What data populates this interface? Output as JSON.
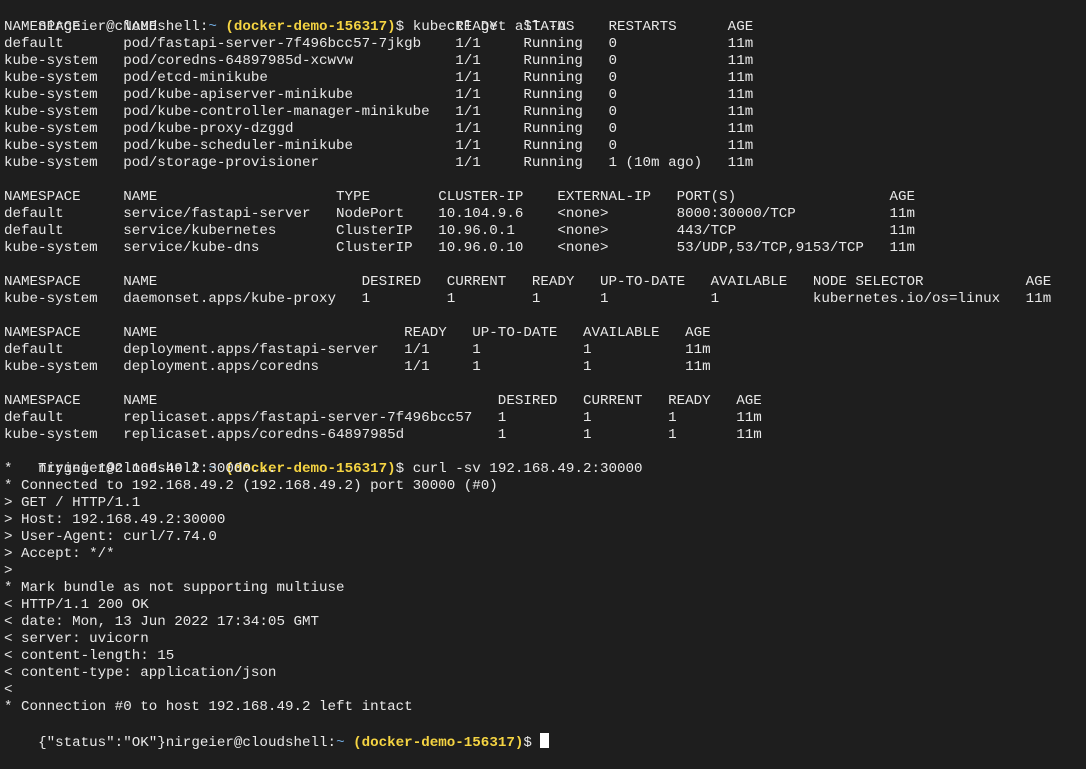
{
  "prompt": {
    "user_host": "nirgeier@cloudshell:",
    "cwd": "~",
    "project": "(docker-demo-156317)",
    "symbol": "$"
  },
  "commands": [
    "kubectl get all -A",
    "curl -sv 192.168.49.2:30000"
  ],
  "lines": [
    "NAMESPACE     NAME                                   READY   STATUS    RESTARTS      AGE",
    "default       pod/fastapi-server-7f496bcc57-7jkgb    1/1     Running   0             11m",
    "kube-system   pod/coredns-64897985d-xcwvw            1/1     Running   0             11m",
    "kube-system   pod/etcd-minikube                      1/1     Running   0             11m",
    "kube-system   pod/kube-apiserver-minikube            1/1     Running   0             11m",
    "kube-system   pod/kube-controller-manager-minikube   1/1     Running   0             11m",
    "kube-system   pod/kube-proxy-dzggd                   1/1     Running   0             11m",
    "kube-system   pod/kube-scheduler-minikube            1/1     Running   0             11m",
    "kube-system   pod/storage-provisioner                1/1     Running   1 (10m ago)   11m",
    "",
    "NAMESPACE     NAME                     TYPE        CLUSTER-IP    EXTERNAL-IP   PORT(S)                  AGE",
    "default       service/fastapi-server   NodePort    10.104.9.6    <none>        8000:30000/TCP           11m",
    "default       service/kubernetes       ClusterIP   10.96.0.1     <none>        443/TCP                  11m",
    "kube-system   service/kube-dns         ClusterIP   10.96.0.10    <none>        53/UDP,53/TCP,9153/TCP   11m",
    "",
    "NAMESPACE     NAME                        DESIRED   CURRENT   READY   UP-TO-DATE   AVAILABLE   NODE SELECTOR            AGE",
    "kube-system   daemonset.apps/kube-proxy   1         1         1       1            1           kubernetes.io/os=linux   11m",
    "",
    "NAMESPACE     NAME                             READY   UP-TO-DATE   AVAILABLE   AGE",
    "default       deployment.apps/fastapi-server   1/1     1            1           11m",
    "kube-system   deployment.apps/coredns          1/1     1            1           11m",
    "",
    "NAMESPACE     NAME                                        DESIRED   CURRENT   READY   AGE",
    "default       replicaset.apps/fastapi-server-7f496bcc57   1         1         1       11m",
    "kube-system   replicaset.apps/coredns-64897985d           1         1         1       11m"
  ],
  "curl_lines": [
    "*   Trying 192.168.49.2:30000...",
    "* Connected to 192.168.49.2 (192.168.49.2) port 30000 (#0)",
    "> GET / HTTP/1.1",
    "> Host: 192.168.49.2:30000",
    "> User-Agent: curl/7.74.0",
    "> Accept: */*",
    ">",
    "* Mark bundle as not supporting multiuse",
    "< HTTP/1.1 200 OK",
    "< date: Mon, 13 Jun 2022 17:34:05 GMT",
    "< server: uvicorn",
    "< content-length: 15",
    "< content-type: application/json",
    "<",
    "* Connection #0 to host 192.168.49.2 left intact"
  ],
  "response_body": "{\"status\":\"OK\"}"
}
